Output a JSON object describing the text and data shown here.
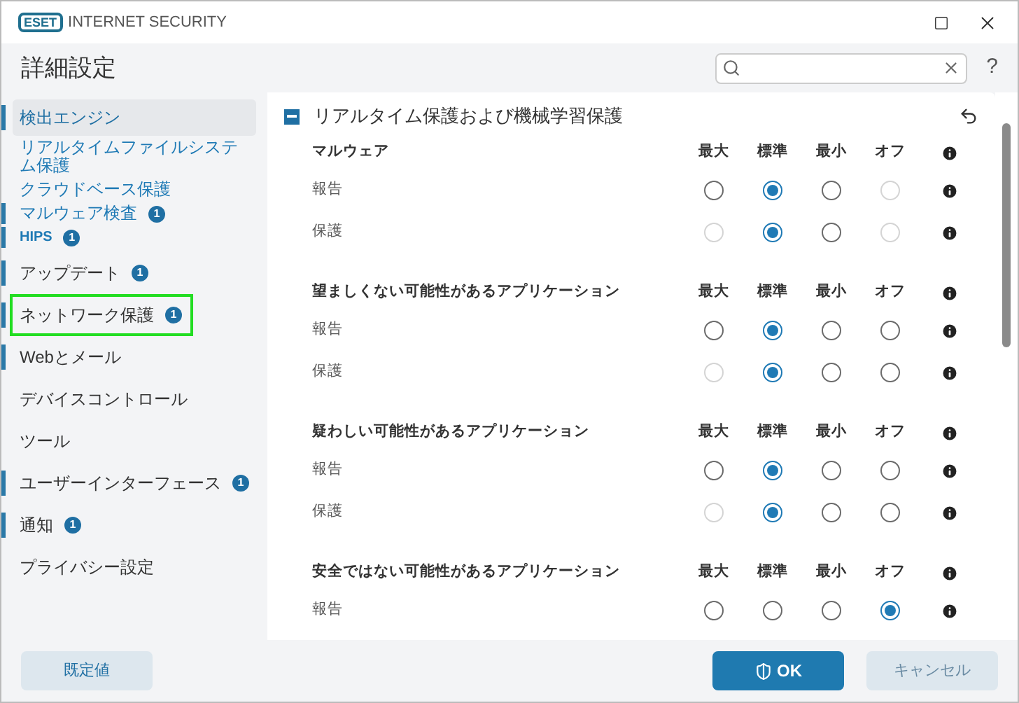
{
  "window": {
    "brand": "ESET",
    "title": "INTERNET SECURITY"
  },
  "header": {
    "title": "詳細設定",
    "help": "?"
  },
  "sidebar": {
    "items": [
      {
        "label": "検出エンジン",
        "selected": true,
        "modified": true,
        "highlighted": false,
        "children": [
          {
            "label": "リアルタイムファイルシステム保護",
            "modified": false
          },
          {
            "label": "クラウドベース保護",
            "modified": false
          },
          {
            "label": "マルウェア検査",
            "badge": "1",
            "modified": true
          },
          {
            "label": "HIPS",
            "badge": "1",
            "modified": true
          }
        ]
      },
      {
        "label": "アップデート",
        "badge": "1",
        "selected": false,
        "modified": true,
        "highlighted": false
      },
      {
        "label": "ネットワーク保護",
        "badge": "1",
        "selected": false,
        "modified": true,
        "highlighted": true
      },
      {
        "label": "Webとメール",
        "selected": false,
        "modified": true,
        "highlighted": false
      },
      {
        "label": "デバイスコントロール",
        "selected": false,
        "modified": false,
        "highlighted": false
      },
      {
        "label": "ツール",
        "selected": false,
        "modified": false,
        "highlighted": false
      },
      {
        "label": "ユーザーインターフェース",
        "badge": "1",
        "selected": false,
        "modified": true,
        "highlighted": false
      },
      {
        "label": "通知",
        "badge": "1",
        "selected": false,
        "modified": true,
        "highlighted": false
      },
      {
        "label": "プライバシー設定",
        "selected": false,
        "modified": false,
        "highlighted": false
      }
    ]
  },
  "section": {
    "title": "リアルタイム保護および機械学習保護",
    "expanded": true,
    "groups": [
      {
        "title": "マルウェア",
        "columns": [
          "最大",
          "標準",
          "最小",
          "オフ"
        ],
        "rows": [
          {
            "label": "報告",
            "options": [
              {
                "selected": false,
                "disabled": false
              },
              {
                "selected": true,
                "disabled": false
              },
              {
                "selected": false,
                "disabled": false
              },
              {
                "selected": false,
                "disabled": true
              }
            ]
          },
          {
            "label": "保護",
            "options": [
              {
                "selected": false,
                "disabled": true
              },
              {
                "selected": true,
                "disabled": false
              },
              {
                "selected": false,
                "disabled": false
              },
              {
                "selected": false,
                "disabled": true
              }
            ]
          }
        ]
      },
      {
        "title": "望ましくない可能性があるアプリケーション",
        "columns": [
          "最大",
          "標準",
          "最小",
          "オフ"
        ],
        "rows": [
          {
            "label": "報告",
            "options": [
              {
                "selected": false,
                "disabled": false
              },
              {
                "selected": true,
                "disabled": false
              },
              {
                "selected": false,
                "disabled": false
              },
              {
                "selected": false,
                "disabled": false
              }
            ]
          },
          {
            "label": "保護",
            "options": [
              {
                "selected": false,
                "disabled": true
              },
              {
                "selected": true,
                "disabled": false
              },
              {
                "selected": false,
                "disabled": false
              },
              {
                "selected": false,
                "disabled": false
              }
            ]
          }
        ]
      },
      {
        "title": "疑わしい可能性があるアプリケーション",
        "columns": [
          "最大",
          "標準",
          "最小",
          "オフ"
        ],
        "rows": [
          {
            "label": "報告",
            "options": [
              {
                "selected": false,
                "disabled": false
              },
              {
                "selected": true,
                "disabled": false
              },
              {
                "selected": false,
                "disabled": false
              },
              {
                "selected": false,
                "disabled": false
              }
            ]
          },
          {
            "label": "保護",
            "options": [
              {
                "selected": false,
                "disabled": true
              },
              {
                "selected": true,
                "disabled": false
              },
              {
                "selected": false,
                "disabled": false
              },
              {
                "selected": false,
                "disabled": false
              }
            ]
          }
        ]
      },
      {
        "title": "安全ではない可能性があるアプリケーション",
        "columns": [
          "最大",
          "標準",
          "最小",
          "オフ"
        ],
        "rows": [
          {
            "label": "報告",
            "options": [
              {
                "selected": false,
                "disabled": false
              },
              {
                "selected": false,
                "disabled": false
              },
              {
                "selected": false,
                "disabled": false
              },
              {
                "selected": true,
                "disabled": false
              }
            ]
          }
        ]
      }
    ]
  },
  "footer": {
    "default_button": "既定値",
    "ok_button": "OK",
    "cancel_button": "キャンセル"
  }
}
